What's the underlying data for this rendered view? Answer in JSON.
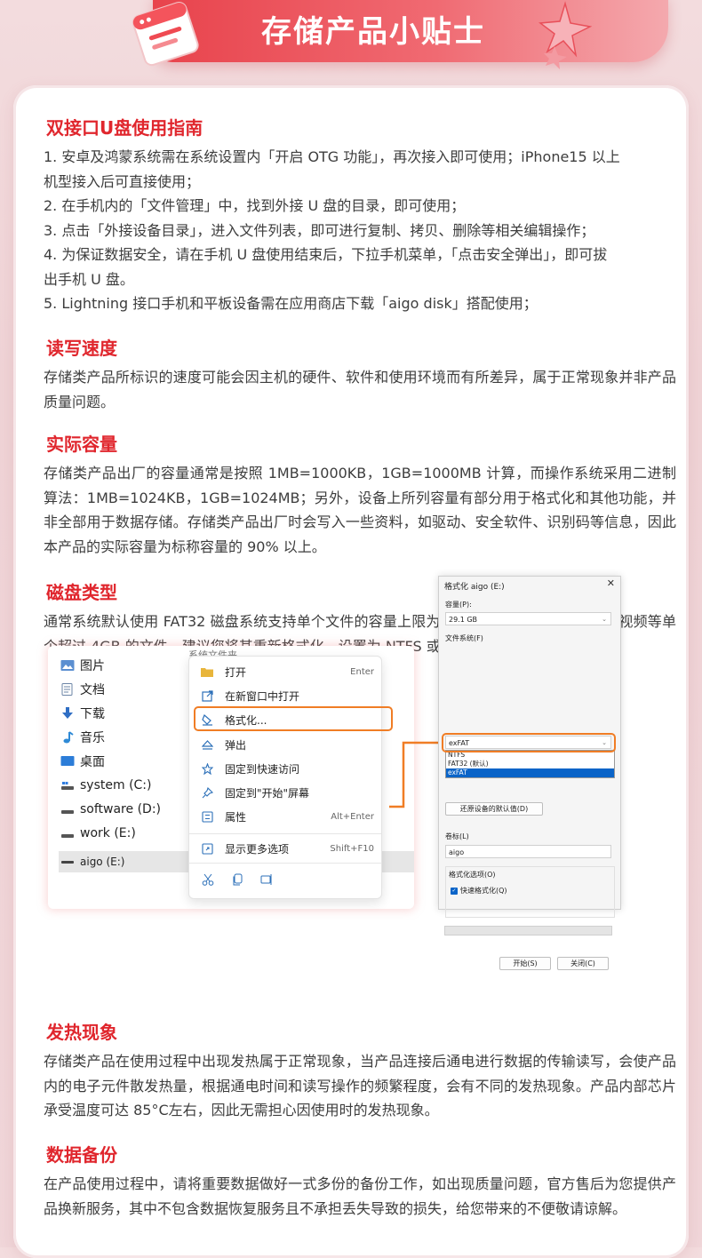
{
  "banner": {
    "title": "存储产品小贴士"
  },
  "sections": {
    "usb": {
      "title": "双接口U盘使用指南",
      "lines": [
        "1. 安卓及鸿蒙系统需在系统设置内「开启 OTG 功能」，再次接入即可使用；iPhone15 以上",
        "机型接入后可直接使用；",
        "2. 在手机内的「文件管理」中，找到外接 U 盘的目录，即可使用；",
        "3. 点击「外接设备目录」，进入文件列表，即可进行复制、拷贝、删除等相关编辑操作；",
        "4. 为保证数据安全，请在手机 U 盘使用结束后，下拉手机菜单，「点击安全弹出」，即可拔",
        "出手机 U 盘。",
        "5. Lightning 接口手机和平板设备需在应用商店下载「aigo disk」搭配使用；"
      ]
    },
    "speed": {
      "title": "读写速度",
      "text": "存储类产品所标识的速度可能会因主机的硬件、软件和使用环境而有所差异，属于正常现象并非产品质量问题。"
    },
    "capacity": {
      "title": "实际容量",
      "text": "存储类产品出厂的容量通常是按照 1MB=1000KB，1GB=1000MB 计算，而操作系统采用二进制算法：1MB=1024KB，1GB=1024MB；另外，设备上所列容量有部分用于格式化和其他功能，并非全部用于数据存储。存储类产品出厂时会写入一些资料，如驱动、安全软件、识别码等信息，因此本产品的实际容量为标称容量的 90% 以上。"
    },
    "disk": {
      "title": "磁盘类型",
      "text": "通常系统默认使用 FAT32 磁盘系统支持单个文件的容量上限为 4GB，如果您需要存储高清视频等单个超过 4GB 的文件，建议您将其重新格式化，设置为 NTFS 或 exFAT 文件系统。"
    },
    "heat": {
      "title": "发热现象",
      "text": "存储类产品在使用过程中出现发热属于正常现象，当产品连接后通电进行数据的传输读写，会使产品内的电子元件散发热量，根据通电时间和读写操作的频繁程度，会有不同的发热现象。产品内部芯片承受温度可达 85°C左右，因此无需担心因使用时的发热现象。"
    },
    "backup": {
      "title": "数据备份",
      "text": "在产品使用过程中，请将重要数据做好一式多份的备份工作，如出现质量问题，官方售后为您提供产品换新服务，其中不包含数据恢复服务且不承担丢失导致的损失，给您带来的不便敬请谅解。"
    }
  },
  "explorer": {
    "behind_label": "系统文件夹",
    "nav": [
      {
        "label": "图片",
        "icon": "pictures-icon"
      },
      {
        "label": "文档",
        "icon": "documents-icon"
      },
      {
        "label": "下载",
        "icon": "download-icon"
      },
      {
        "label": "音乐",
        "icon": "music-icon"
      },
      {
        "label": "桌面",
        "icon": "desktop-icon"
      },
      {
        "label": "system (C:)",
        "icon": "drive-icon"
      },
      {
        "label": "software (D:)",
        "icon": "drive-icon"
      },
      {
        "label": "work (E:)",
        "icon": "drive-icon"
      },
      {
        "label": "aigo (E:)",
        "icon": "usb-drive-icon"
      }
    ]
  },
  "context_menu": {
    "items": [
      {
        "label": "打开",
        "shortcut": "Enter"
      },
      {
        "label": "在新窗口中打开",
        "shortcut": ""
      },
      {
        "label": "格式化...",
        "shortcut": ""
      },
      {
        "label": "弹出",
        "shortcut": ""
      },
      {
        "label": "固定到快速访问",
        "shortcut": ""
      },
      {
        "label": "固定到\"开始\"屏幕",
        "shortcut": ""
      },
      {
        "label": "属性",
        "shortcut": "Alt+Enter"
      },
      {
        "label": "显示更多选项",
        "shortcut": "Shift+F10"
      }
    ]
  },
  "format_dialog": {
    "title": "格式化 aigo (E:)",
    "capacity_label": "容量(P):",
    "capacity_value": "29.1 GB",
    "fs_label": "文件系统(F)",
    "fs_value": "exFAT",
    "fs_options": [
      "NTFS",
      "FAT32 (默认)",
      "exFAT"
    ],
    "restore_button": "还原设备的默认值(D)",
    "volume_label": "卷标(L)",
    "volume_value": "aigo",
    "options_label": "格式化选项(O)",
    "quick_format": "快速格式化(Q)",
    "start_button": "开始(S)",
    "close_button": "关闭(C)"
  }
}
